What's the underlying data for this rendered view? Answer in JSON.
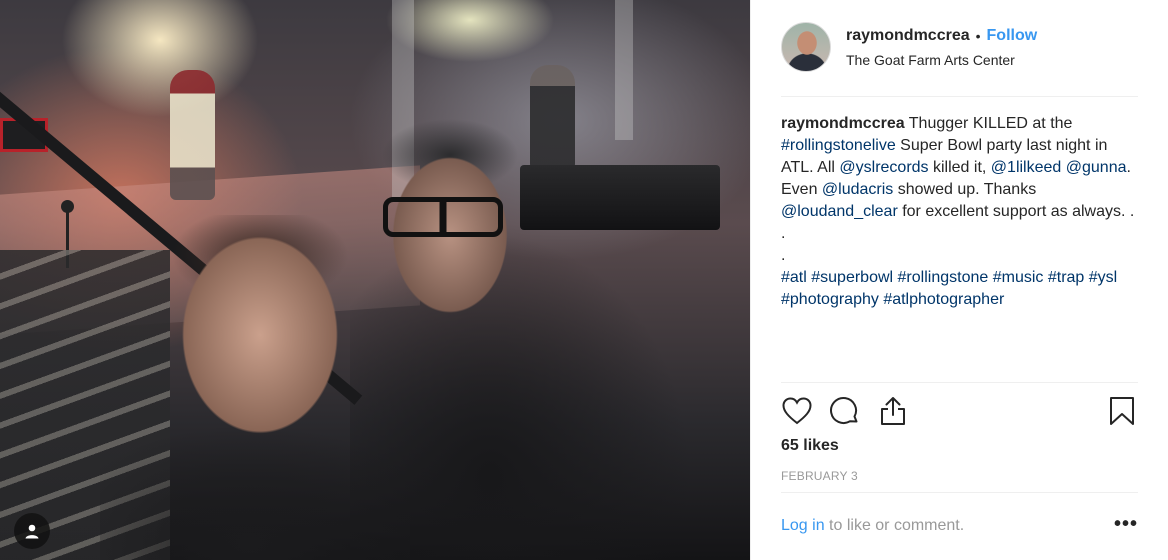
{
  "post": {
    "username": "raymondmccrea",
    "separator": "•",
    "follow_label": "Follow",
    "location": "The Goat Farm Arts Center"
  },
  "caption": {
    "username": "raymondmccrea",
    "t1": " Thugger KILLED at the ",
    "tag_rollingstonelive": "#rollingstonelive",
    "t2": " Super Bowl party last night in ATL. All ",
    "mention_yslrecords": "@yslrecords",
    "t3": " killed it, ",
    "mention_1lilkeed": "@1lilkeed",
    "t4": " ",
    "mention_gunna": "@gunna",
    "t5": ". Even ",
    "mention_ludacris": "@ludacris",
    "t6": " showed up. Thanks ",
    "mention_loudand_clear": "@loudand_clear",
    "t7": " for excellent support as always. .",
    "dot1": ".",
    "dot2": ".",
    "hashtags": [
      "#atl",
      "#superbowl",
      "#rollingstone",
      "#music",
      "#trap",
      "#ysl",
      "#photography",
      "#atlphotographer"
    ]
  },
  "actions": {
    "like_icon": "heart-icon",
    "comment_icon": "comment-icon",
    "share_icon": "share-icon",
    "save_icon": "bookmark-icon"
  },
  "likes": "65 likes",
  "date": "FEBRUARY 3",
  "footer": {
    "login_link": "Log in",
    "login_text": " to like or comment.",
    "more_label": "•••"
  },
  "photo": {
    "user_tag_icon": "user-icon"
  },
  "colors": {
    "link_blue": "#3897f0",
    "caption_link": "#003569",
    "muted": "#999999",
    "text": "#262626"
  }
}
